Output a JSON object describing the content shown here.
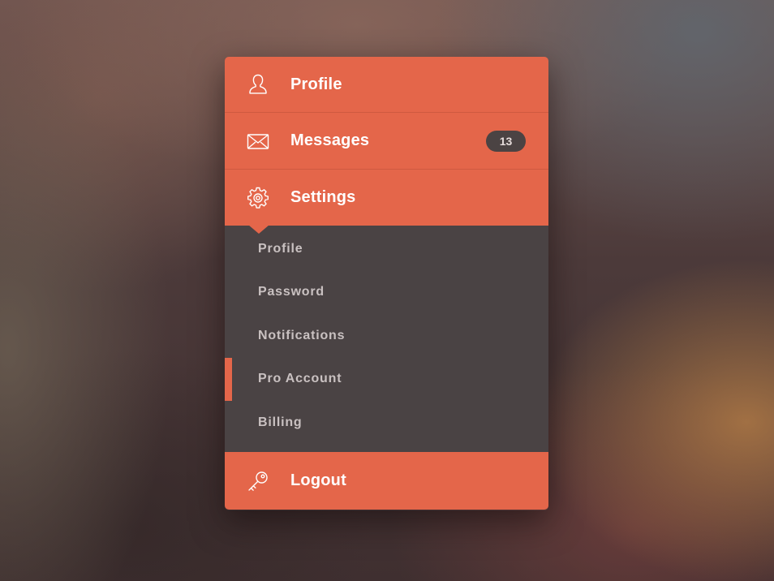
{
  "menu": {
    "items": [
      {
        "id": "profile",
        "label": "Profile",
        "icon": "user-icon"
      },
      {
        "id": "messages",
        "label": "Messages",
        "icon": "envelope-icon",
        "badge": "13"
      },
      {
        "id": "settings",
        "label": "Settings",
        "icon": "gear-icon",
        "expanded": true
      }
    ],
    "settings_submenu": [
      {
        "label": "Profile"
      },
      {
        "label": "Password"
      },
      {
        "label": "Notifications"
      },
      {
        "label": "Pro Account",
        "active": true
      },
      {
        "label": "Billing"
      }
    ],
    "logout": {
      "label": "Logout",
      "icon": "key-icon"
    }
  },
  "colors": {
    "accent": "#e4664a",
    "submenu_bg": "#4a4344",
    "badge_bg": "#4b4343",
    "submenu_text": "#c9c1c1",
    "primary_text": "#ffffff"
  }
}
